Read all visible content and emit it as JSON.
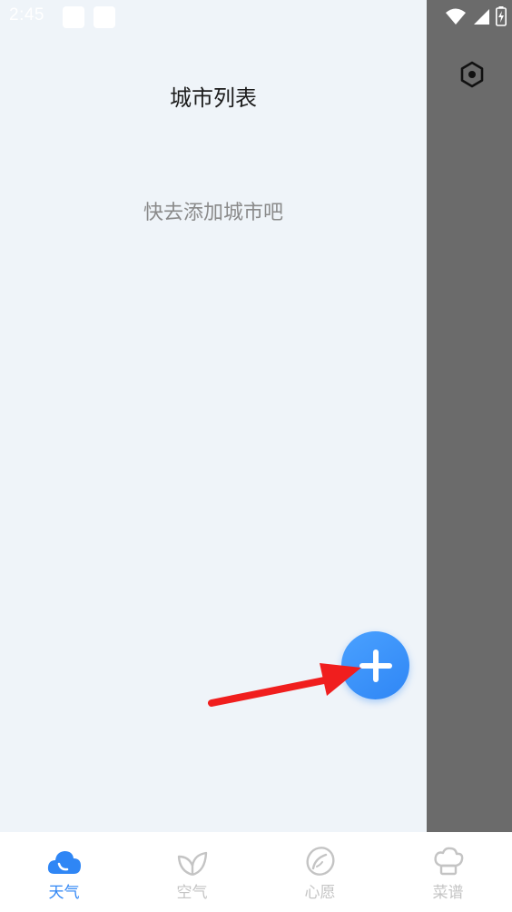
{
  "status_bar": {
    "time": "2:45"
  },
  "drawer": {
    "title": "城市列表",
    "empty_hint": "快去添加城市吧"
  },
  "overlay": {
    "settings_icon": "settings-hexagon-icon"
  },
  "fab": {
    "icon": "plus-icon"
  },
  "annotation": {
    "arrow_color": "#f01e1e"
  },
  "bottom_nav": {
    "items": [
      {
        "label": "天气",
        "icon": "cloud-icon",
        "active": true
      },
      {
        "label": "空气",
        "icon": "leaf-icon",
        "active": false
      },
      {
        "label": "心愿",
        "icon": "wish-icon",
        "active": false
      },
      {
        "label": "菜谱",
        "icon": "chef-hat-icon",
        "active": false
      }
    ]
  },
  "colors": {
    "accent": "#2f86f5",
    "overlay": "#6b6b6b",
    "background": "#eff4f9",
    "inactive": "#c4c4c4"
  }
}
